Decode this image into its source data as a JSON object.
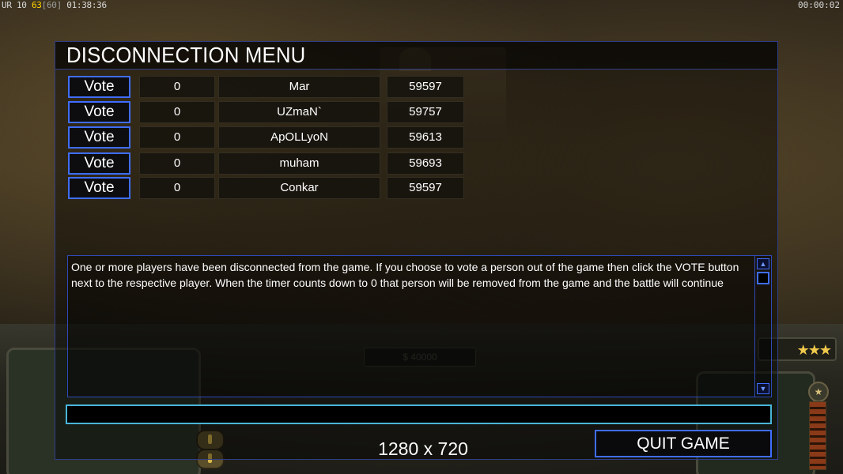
{
  "hud": {
    "ur_label": "UR",
    "ur_value": "10",
    "fps": "63",
    "fps_cap": "[60]",
    "game_clock": "01:38:36",
    "real_clock": "00:00:02",
    "money": "$ 40000",
    "rank_stars": "★★★"
  },
  "dialog": {
    "title": "DISCONNECTION MENU",
    "vote_label": "Vote",
    "players": [
      {
        "timer": "0",
        "name": "Mar",
        "ping": "59597"
      },
      {
        "timer": "0",
        "name": "UZmaN`",
        "ping": "59757"
      },
      {
        "timer": "0",
        "name": "ApOLLyoN",
        "ping": "59613"
      },
      {
        "timer": "0",
        "name": "muham",
        "ping": "59693"
      },
      {
        "timer": "0",
        "name": "Conkar",
        "ping": "59597"
      }
    ],
    "message": "One or more players have been disconnected from the game. If you choose to vote a person out of the game then click the VOTE button next to the respective player. When the timer counts down to 0 that person will be removed from the game and the battle will continue",
    "chat_value": "",
    "resolution": "1280 x 720",
    "quit_label": "QUIT GAME"
  },
  "colors": {
    "button_border": "#3f6dff",
    "chat_border": "#49b5d8",
    "dialog_border": "#2f3e86",
    "fps_color": "#ffd400"
  },
  "icons": {
    "scroll_up": "triangle-up-icon",
    "scroll_down": "triangle-down-icon",
    "rank": "star-icon"
  }
}
